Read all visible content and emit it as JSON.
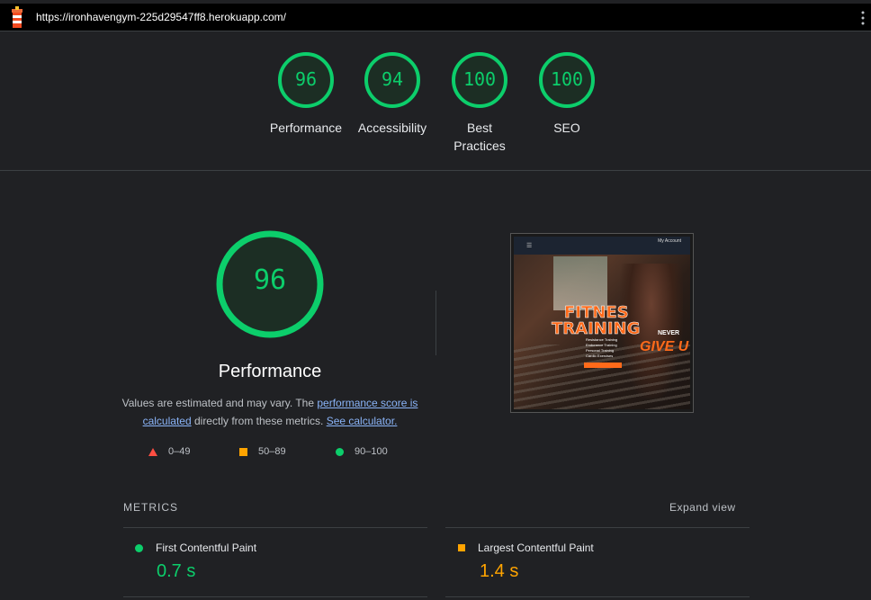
{
  "browser": {
    "url": "https://ironhavengym-225d29547ff8.herokuapp.com/"
  },
  "categories": [
    {
      "label": "Performance",
      "score": "96",
      "color": "#0cce6b"
    },
    {
      "label": "Accessibility",
      "score": "94",
      "color": "#0cce6b"
    },
    {
      "label": "Best Practices",
      "score": "100",
      "color": "#0cce6b"
    },
    {
      "label": "SEO",
      "score": "100",
      "color": "#0cce6b"
    }
  ],
  "performance": {
    "score": "96",
    "title": "Performance",
    "desc_prefix": "Values are estimated and may vary. The ",
    "desc_link1": "performance score is calculated",
    "desc_middle": " directly from these metrics. ",
    "desc_link2": "See calculator."
  },
  "legend": {
    "fail": "0–49",
    "average": "50–89",
    "pass": "90–100"
  },
  "thumbnail": {
    "account_label": "My Account",
    "hero_line1": "FITNES",
    "hero_line2": "TRAINING",
    "tag_never": "NEVER",
    "tag_give": "GIVE U",
    "list": [
      "Resistance Training",
      "Endurance Training",
      "Personal Training",
      "Cardio Exercises"
    ]
  },
  "metrics": {
    "title": "METRICS",
    "expand_label": "Expand view",
    "items": [
      {
        "name": "First Contentful Paint",
        "value": "0.7 s",
        "color": "#0cce6b"
      },
      {
        "name": "Largest Contentful Paint",
        "value": "1.4 s",
        "color": "#ffa400"
      }
    ]
  }
}
